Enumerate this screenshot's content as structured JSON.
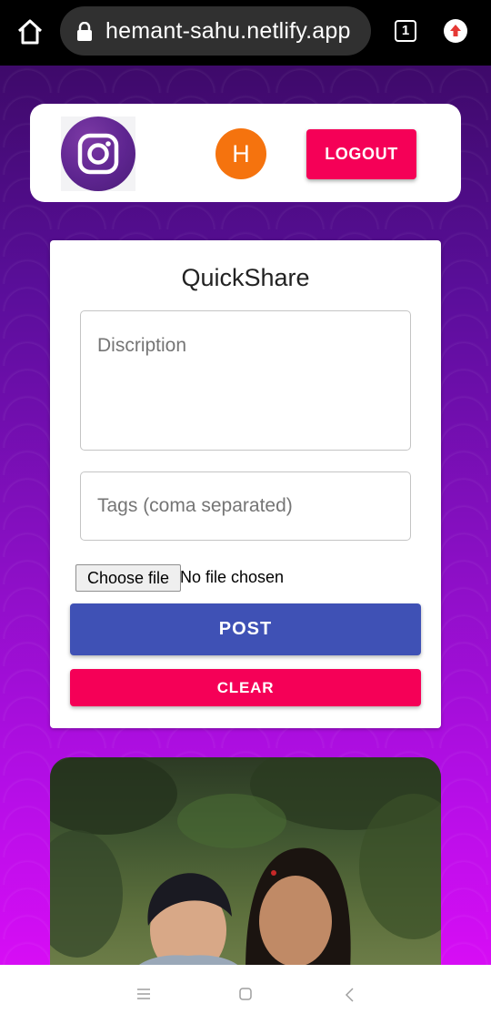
{
  "browser": {
    "url": "hemant-sahu.netlify.app",
    "tab_count": "1"
  },
  "header": {
    "avatar_initial": "H",
    "logout_label": "LOGOUT"
  },
  "form": {
    "title": "QuickShare",
    "description_placeholder": "Discription",
    "tags_placeholder": "Tags (coma separated)",
    "choose_file_label": "Choose file",
    "no_file_text": "No file chosen",
    "post_label": "POST",
    "clear_label": "CLEAR"
  },
  "colors": {
    "logout": "#f50057",
    "post": "#3f51b5",
    "clear": "#f50057",
    "avatar": "#f5730e"
  },
  "icons": {
    "home": "home-icon",
    "lock": "lock-icon",
    "upgrade": "upgrade-icon",
    "logo": "instagram-logo-icon",
    "nav_menu": "menu-icon",
    "nav_home": "square-icon",
    "nav_back": "back-icon"
  }
}
